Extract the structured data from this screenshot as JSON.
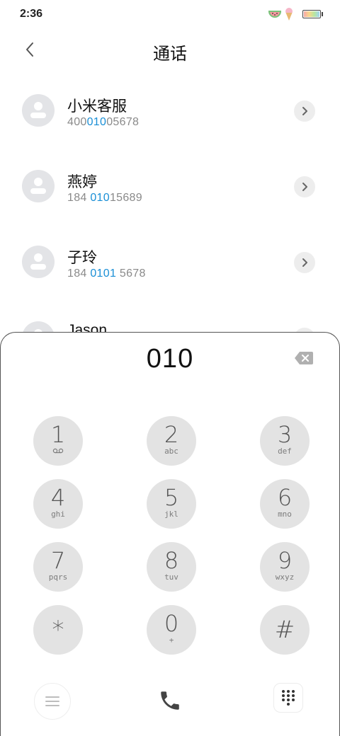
{
  "status_bar": {
    "time": "2:36",
    "icons": [
      "watermelon-icon",
      "ice-cream-icon",
      "battery-icon"
    ]
  },
  "header": {
    "title": "通话",
    "back_icon": "chevron-left-icon"
  },
  "contacts": [
    {
      "name": "小米客服",
      "number_parts": [
        "400",
        "010",
        "05678"
      ]
    },
    {
      "name": "燕婷",
      "number_parts": [
        "184 ",
        "010",
        "15689"
      ]
    },
    {
      "name": "子玲",
      "number_parts": [
        "184 ",
        "0101",
        " 5678"
      ]
    },
    {
      "name": "Jason",
      "number_parts": [
        "",
        "",
        ""
      ]
    }
  ],
  "dialer": {
    "input_value": "010",
    "delete_icon": "backspace-icon",
    "keys": [
      {
        "digit": "1",
        "letters": "",
        "sub_icon": "voicemail-icon"
      },
      {
        "digit": "2",
        "letters": "abc"
      },
      {
        "digit": "3",
        "letters": "def"
      },
      {
        "digit": "4",
        "letters": "ghi"
      },
      {
        "digit": "5",
        "letters": "jkl"
      },
      {
        "digit": "6",
        "letters": "mno"
      },
      {
        "digit": "7",
        "letters": "pqrs"
      },
      {
        "digit": "8",
        "letters": "tuv"
      },
      {
        "digit": "9",
        "letters": "wxyz"
      },
      {
        "digit": "*",
        "letters": ""
      },
      {
        "digit": "0",
        "letters": "+"
      },
      {
        "digit": "#",
        "letters": ""
      }
    ]
  },
  "bottom_bar": {
    "menu_icon": "menu-icon",
    "call_icon": "phone-icon",
    "keypad_icon": "dialpad-icon"
  },
  "colors": {
    "highlight": "#1a8fd6",
    "key_background": "#e3e3e3",
    "avatar_background": "#e3e4e7",
    "call_icon": "#444444"
  }
}
